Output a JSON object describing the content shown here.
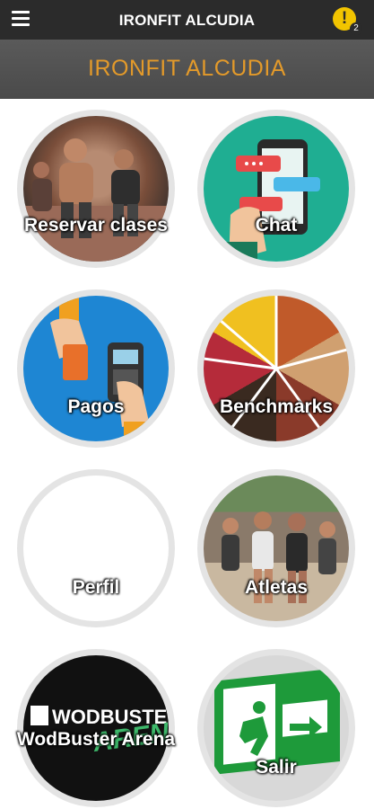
{
  "header": {
    "title": "IRONFIT ALCUDIA",
    "notification_symbol": "!",
    "notification_count": "2"
  },
  "banner": {
    "title": "IRONFIT ALCUDIA"
  },
  "menu": [
    {
      "label": "Reservar clases",
      "icon": "athletes-running-photo"
    },
    {
      "label": "Chat",
      "icon": "phone-chat-bubbles-icon"
    },
    {
      "label": "Pagos",
      "icon": "card-payment-terminal-icon"
    },
    {
      "label": "Benchmarks",
      "icon": "sports-collage-photo"
    },
    {
      "label": "Perfil",
      "icon": "empty-profile-avatar"
    },
    {
      "label": "Atletas",
      "icon": "race-runners-photo"
    },
    {
      "label": "WodBuster Arena",
      "icon": "wodbuster-arena-logo",
      "logo_text": "WODBUSTER",
      "logo_subtext": "ARENA"
    },
    {
      "label": "Salir",
      "icon": "exit-sign-icon"
    }
  ],
  "colors": {
    "topbar": "#2b2b2b",
    "banner": "#505050",
    "banner_title": "#e39a2a",
    "notification": "#f2c400"
  }
}
